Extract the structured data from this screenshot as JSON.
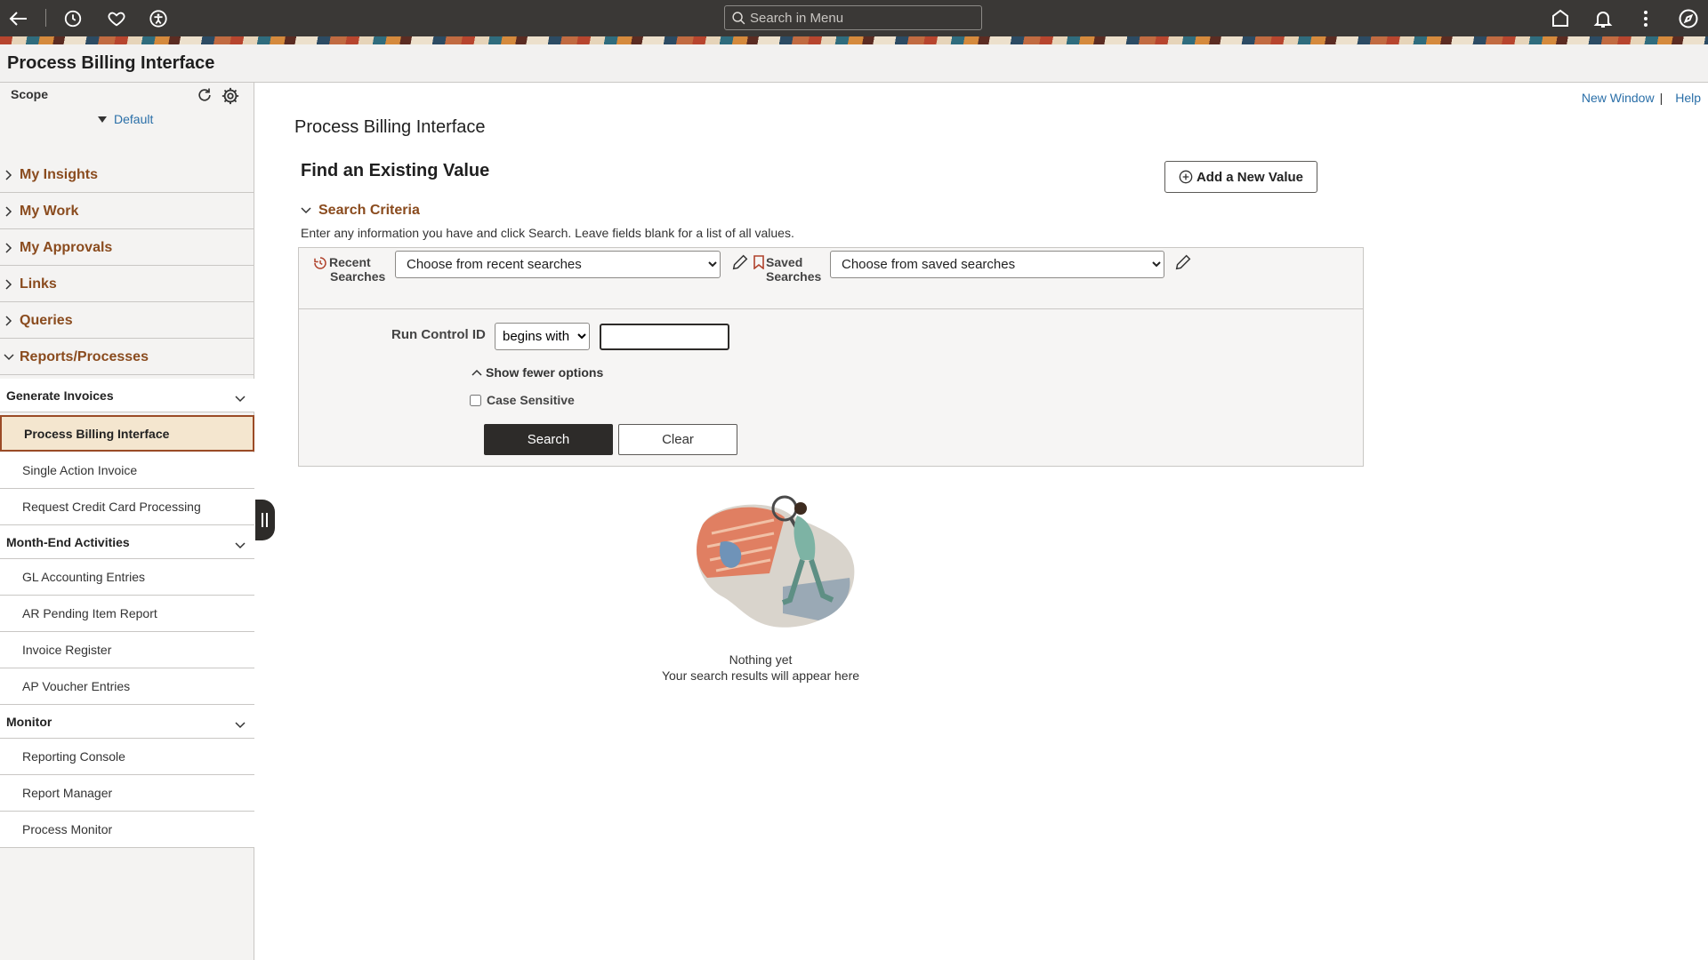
{
  "topbar": {
    "search_placeholder": "Search in Menu",
    "icons": [
      "back-arrow-icon",
      "history-icon",
      "heart-icon",
      "accessibility-icon",
      "home-icon",
      "bell-icon",
      "kebab-menu-icon",
      "compass-icon"
    ]
  },
  "page": {
    "title": "Process Billing Interface"
  },
  "sidebar": {
    "scope_label": "Scope",
    "scope_value": "Default",
    "sections": [
      "My Insights",
      "My Work",
      "My Approvals",
      "Links",
      "Queries",
      "Reports/Processes"
    ],
    "groups": [
      {
        "title": "Generate Invoices",
        "items": [
          "Process Billing Interface",
          "Single Action Invoice",
          "Request Credit Card Processing"
        ]
      },
      {
        "title": "Month-End Activities",
        "items": [
          "GL Accounting Entries",
          "AR Pending Item Report",
          "Invoice Register",
          "AP Voucher Entries"
        ]
      },
      {
        "title": "Monitor",
        "items": [
          "Reporting Console",
          "Report Manager",
          "Process Monitor"
        ]
      }
    ]
  },
  "header_links": {
    "new_window": "New Window",
    "separator": "|",
    "help": "Help"
  },
  "main": {
    "heading": "Process Billing Interface",
    "find_heading": "Find an Existing Value",
    "add_button": "Add a New Value",
    "criteria_title": "Search Criteria",
    "instructions": "Enter any information you have and click Search. Leave fields blank for a list of all values.",
    "recent_label_1": "Recent",
    "recent_label_2": "Searches",
    "recent_select": "Choose from recent searches",
    "saved_label_1": "Saved",
    "saved_label_2": "Searches",
    "saved_select": "Choose from saved searches",
    "run_control_label": "Run Control ID",
    "operator": "begins with",
    "run_control_value": "",
    "fewer_options": "Show fewer options",
    "case_sensitive": "Case Sensitive",
    "search_button": "Search",
    "clear_button": "Clear",
    "empty_title": "Nothing yet",
    "empty_sub": "Your search results will appear here"
  }
}
